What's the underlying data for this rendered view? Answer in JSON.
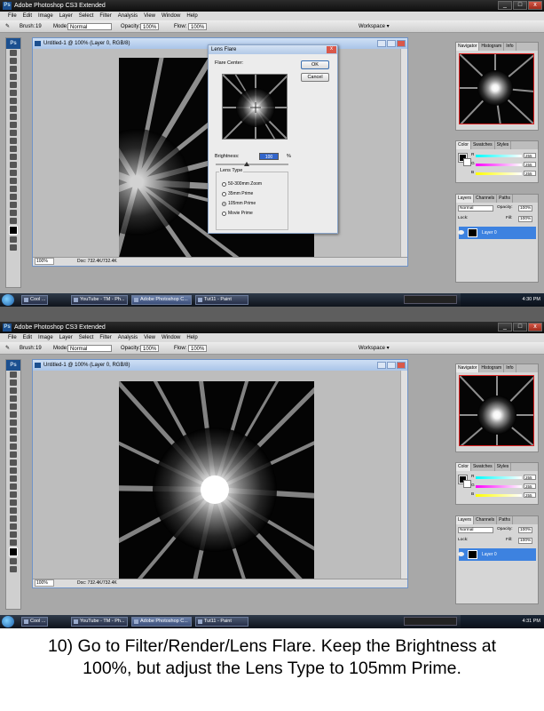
{
  "app": {
    "title": "Adobe Photoshop CS3 Extended",
    "menu": [
      "File",
      "Edit",
      "Image",
      "Layer",
      "Select",
      "Filter",
      "Analysis",
      "View",
      "Window",
      "Help"
    ],
    "options": {
      "brush_label": "Brush:",
      "brush_size": "19",
      "mode_label": "Mode:",
      "mode_value": "Normal",
      "opacity_label": "Opacity:",
      "opacity_value": "100%",
      "flow_label": "Flow:",
      "flow_value": "100%",
      "workspace_label": "Workspace ▾"
    }
  },
  "document": {
    "title": "Untitled-1 @ 100% (Layer 0, RGB/8)",
    "zoom": "100%",
    "doc_size": "Doc: 732.4K/732.4K"
  },
  "dialog": {
    "title": "Lens Flare",
    "flare_center_label": "Flare Center:",
    "ok_label": "OK",
    "cancel_label": "Cancel",
    "brightness_label": "Brightness:",
    "brightness_value": "100",
    "brightness_unit": "%",
    "lens_type_label": "Lens Type",
    "lens_options": [
      "50-300mm Zoom",
      "35mm Prime",
      "105mm Prime",
      "Movie Prime"
    ],
    "selected_lens": "105mm Prime"
  },
  "panels": {
    "navigator_tabs": [
      "Navigator",
      "Histogram",
      "Info"
    ],
    "color_tabs": [
      "Color",
      "Swatches",
      "Styles"
    ],
    "color_channels": [
      {
        "name": "R",
        "value": "255"
      },
      {
        "name": "G",
        "value": "255"
      },
      {
        "name": "B",
        "value": "255"
      }
    ],
    "layers_tabs": [
      "Layers",
      "Channels",
      "Paths"
    ],
    "blend_mode": "Normal",
    "opacity_label": "Opacity:",
    "opacity_value": "100%",
    "lock_label": "Lock:",
    "fill_label": "Fill:",
    "fill_value": "100%",
    "layer_name": "Layer 0"
  },
  "taskbar": {
    "items": [
      "Cool ...",
      "YouTube - TM - Ph...",
      "Adobe Photoshop C...",
      "Tut11 - Paint"
    ],
    "time_1": "4:30 PM",
    "time_2": "4:31 PM"
  },
  "caption": "10) Go to Filter/Render/Lens Flare. Keep the Brightness at 100%, but adjust the Lens Type to 105mm Prime."
}
